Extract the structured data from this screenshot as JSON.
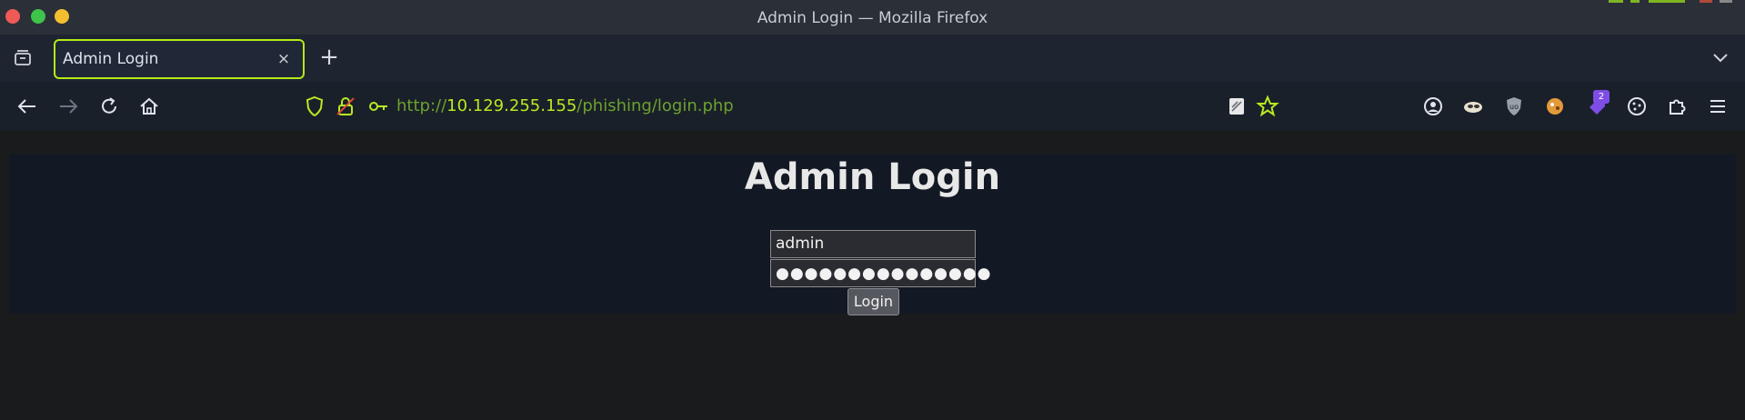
{
  "window": {
    "title": "Admin Login — Mozilla Firefox"
  },
  "tabs": [
    {
      "label": "Admin Login",
      "close": "×"
    }
  ],
  "newtab_label": "+",
  "navbar": {
    "url_scheme": "http://",
    "url_host": "10.129.255.155",
    "url_path": "/phishing/login.php",
    "extension_badge": "2"
  },
  "icons": {
    "back": "arrow-left-icon",
    "forward": "arrow-right-icon",
    "reload": "reload-icon",
    "home": "home-icon",
    "shield": "shield-icon",
    "lock": "insecure-lock-icon",
    "key": "key-icon",
    "reader": "reader-view-icon",
    "bookmark": "star-icon",
    "account": "account-icon",
    "menu": "hamburger-menu-icon"
  },
  "colors": {
    "accent": "#b4ea18",
    "url_path": "#6ca12f",
    "badge": "#7e4de6"
  },
  "page": {
    "heading": "Admin Login",
    "username_value": "admin",
    "password_mask": "●●●●●●●●●●●●●●●",
    "login_label": "Login"
  }
}
